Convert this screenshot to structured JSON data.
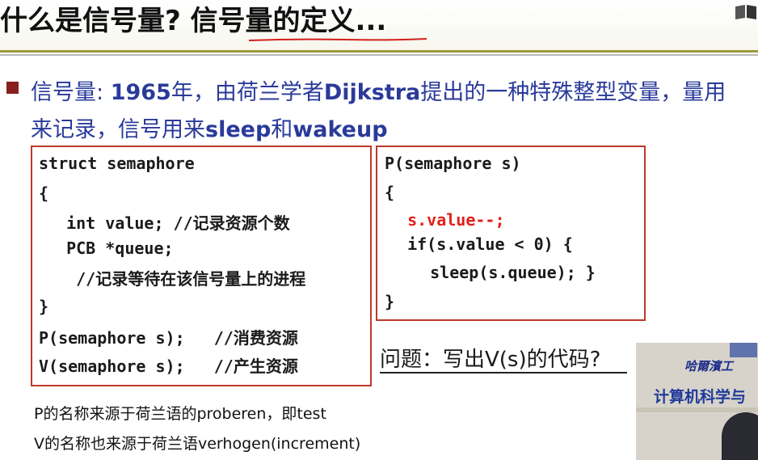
{
  "title": {
    "text": "什么是信号量? 信号量的定义..."
  },
  "definition": {
    "line1_part1": "信号量: ",
    "line1_year": "1965",
    "line1_part2": "年，由荷兰学者",
    "line1_name": "Dijkstra",
    "line1_part3": "提出的一种特殊整型变量，量用",
    "line2_part1": "来记录，信号用来",
    "line2_sleep": "sleep",
    "line2_and": "和",
    "line2_wakeup": "wakeup"
  },
  "struct_code": [
    "struct semaphore",
    "{",
    "  int value; //记录资源个数",
    "  PCB *queue;",
    "   //记录等待在该信号量上的进程",
    "}",
    "P(semaphore s);   //消费资源",
    "V(semaphore s);   //产生资源"
  ],
  "p_code": [
    "P(semaphore s)",
    "{",
    "  s.value--;",
    "  if(s.value < 0) {",
    "   sleep(s.queue); }",
    "}"
  ],
  "question": "问题：写出V(s)的代码?",
  "notes": [
    "P的名称来源于荷兰语的proberen，即test",
    "V的名称也来源于荷兰语verhogen(increment)"
  ],
  "video": {
    "sign_top": "哈爾濱工",
    "sign_main": "计算机科学与"
  },
  "colors": {
    "definition_text": "#2a3a9a",
    "box_border": "#c0392b",
    "highlight_code": "#e0201a",
    "bullet": "#8a1f1f",
    "title_rule": "#9a9a3a"
  }
}
